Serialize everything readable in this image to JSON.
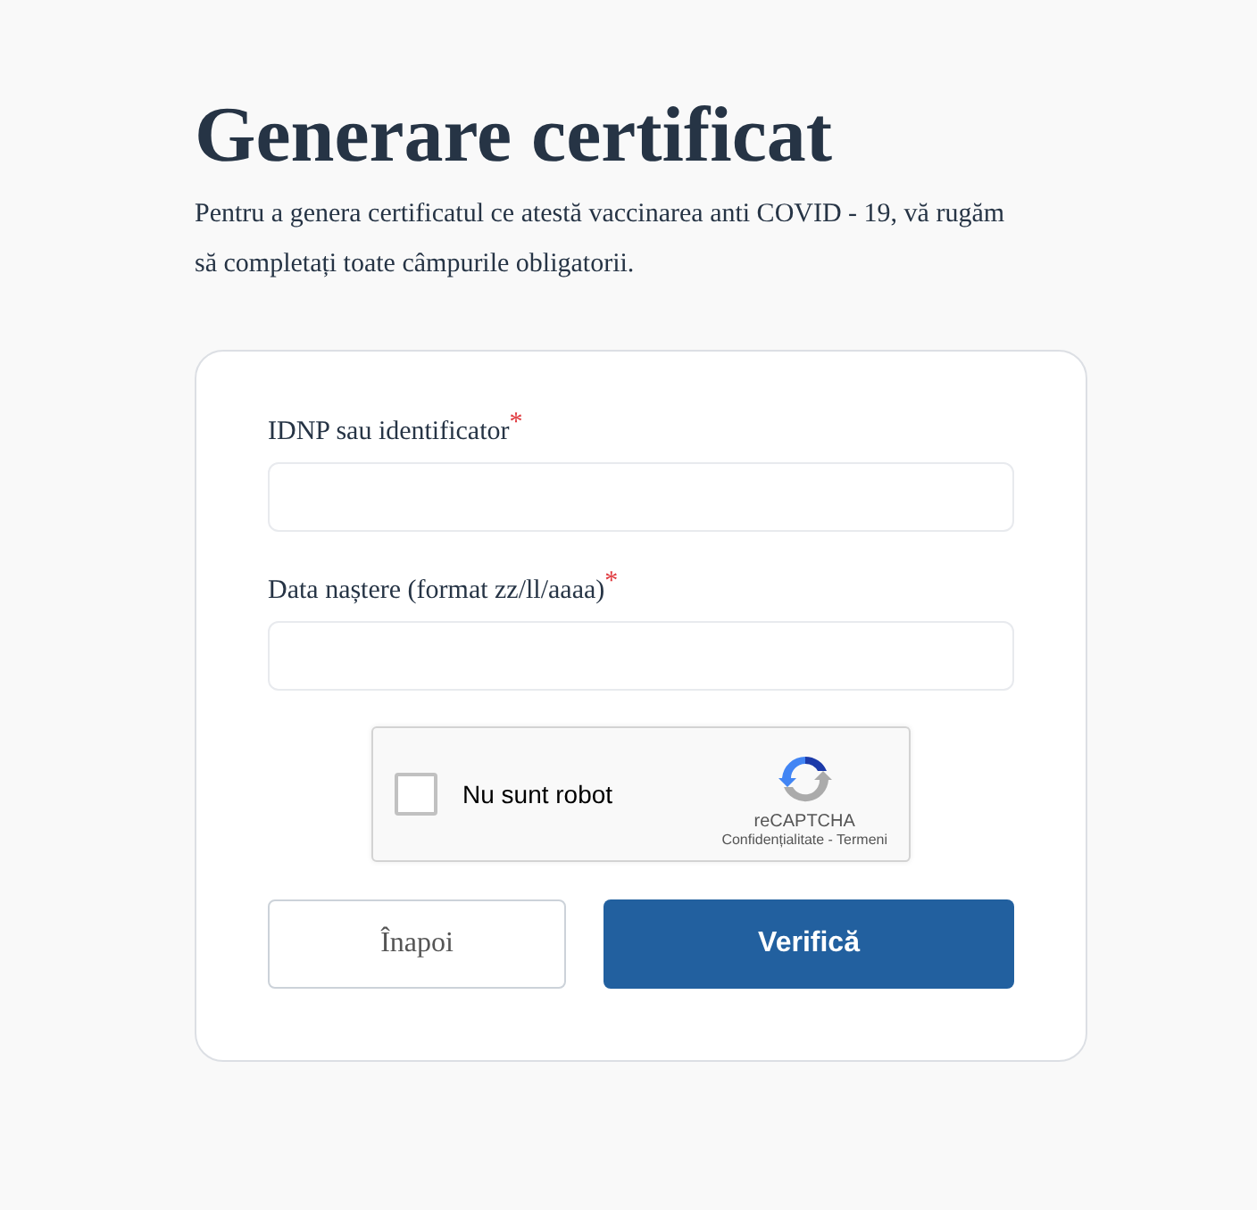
{
  "title": "Generare certificat",
  "intro": "Pentru a genera certificatul ce atestă vaccinarea anti COVID - 19, vă rugăm să completați toate câmpurile obligatorii.",
  "fields": [
    {
      "label": "IDNP sau identificator",
      "required_mark": "*"
    },
    {
      "label": "Data naștere (format zz/ll/aaaa)",
      "required_mark": "*"
    }
  ],
  "captcha": {
    "label": "Nu sunt robot",
    "checked": false,
    "brand": "reCAPTCHA",
    "links": "Confidențialitate - Termeni"
  },
  "buttons": [
    {
      "label": "Înapoi",
      "kind": "secondary"
    },
    {
      "label": "Verifică",
      "kind": "primary"
    }
  ]
}
